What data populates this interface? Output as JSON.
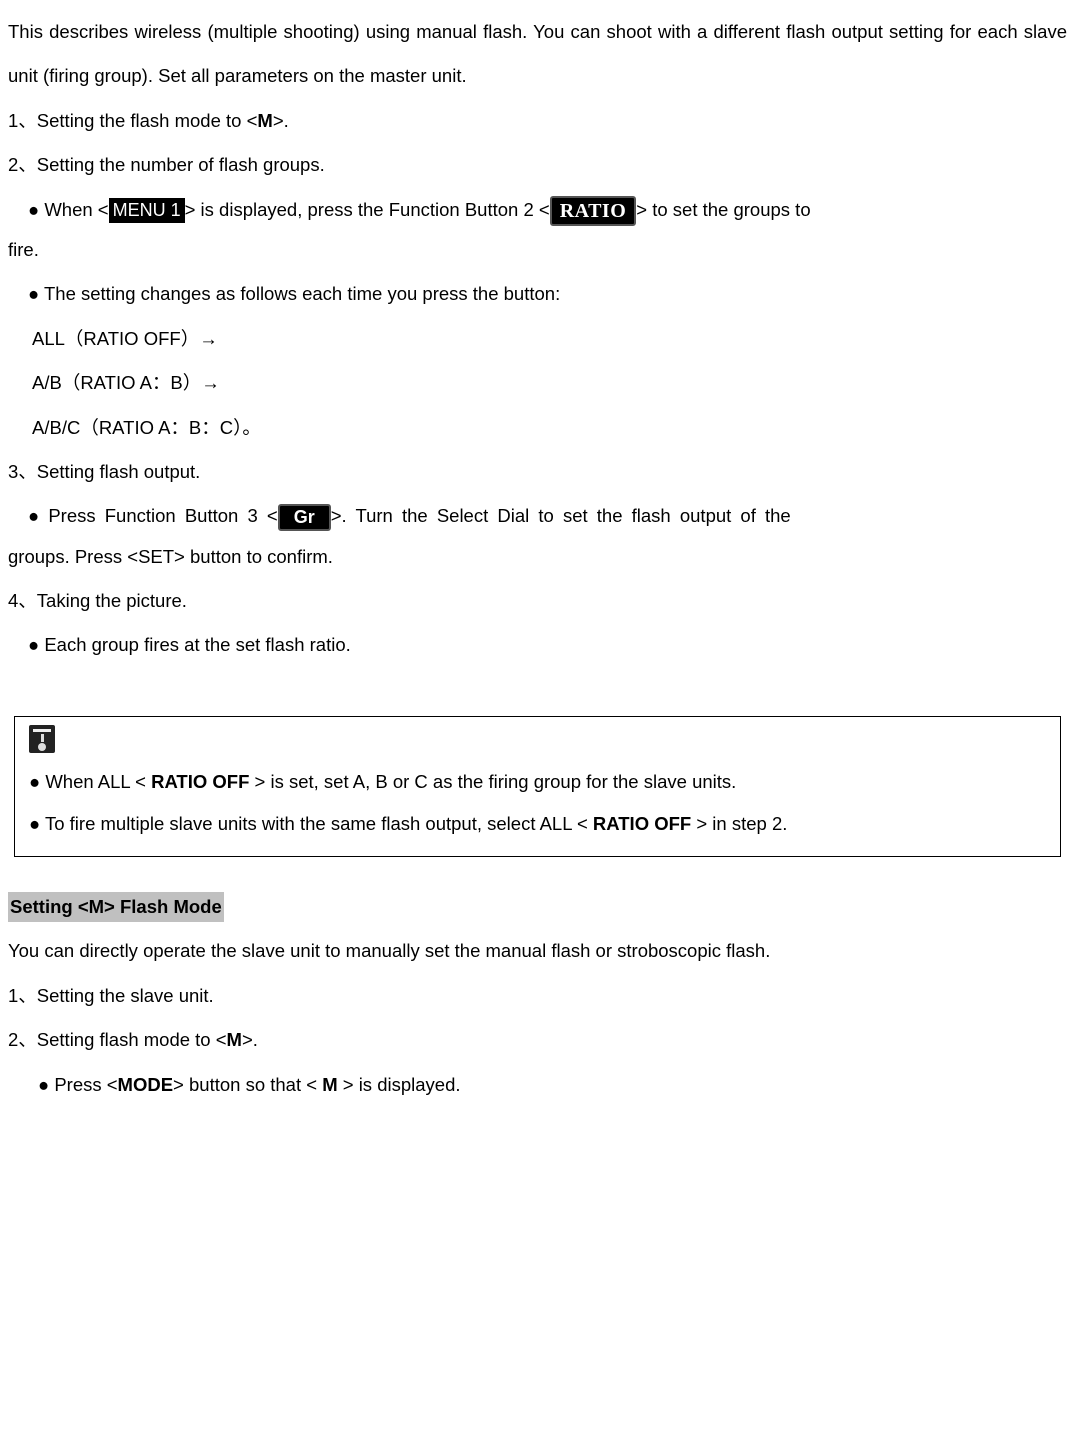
{
  "intro": "This describes wireless (multiple shooting) using manual flash. You can shoot with a different flash output setting for each slave unit (firing group). Set all parameters on the master unit.",
  "step1_pre": "1、Setting the flash mode to <",
  "step1_M": "M",
  "step1_post": ">.",
  "step2": "2、Setting the number of flash groups.",
  "step2_b1_pre": "● When <",
  "step2_b1_menu": "MENU 1",
  "step2_b1_mid": "> is displayed, press the Function Button 2 <",
  "step2_b1_ratio": "RATIO",
  "step2_b1_post": "> to set the groups to",
  "step2_b1_tail": "fire.",
  "step2_b2": "● The setting changes as follows each time you press the button:",
  "step2_seq1": "ALL（RATIO OFF）→",
  "step2_seq2": "A/B（RATIO A：B）→",
  "step2_seq3": "A/B/C（RATIO A：B：C）。",
  "step3": "3、Setting flash output.",
  "step3_b1_pre": "● Press Function Button 3 <",
  "step3_b1_gr": "Gr",
  "step3_b1_post": ">. Turn the Select Dial to set the flash output of the",
  "step3_tail": "groups. Press <SET> button to confirm.",
  "step4": "4、Taking the picture.",
  "step4_b1": "● Each group fires at the set flash ratio.",
  "note1_pre": "● When ALL < ",
  "note1_ratio_off": "RATIO OFF",
  "note1_post": " > is set, set A, B or C as the firing group for the slave units.",
  "note2_pre": "● To fire multiple slave units with the same flash output, select ALL < ",
  "note2_ratio_off": "RATIO OFF",
  "note2_post": " > in step 2.",
  "heading2": "Setting <M> Flash Mode",
  "sec2_intro": "You can directly operate the slave unit to manually set the manual flash or stroboscopic flash.",
  "sec2_step1": "1、Setting the slave unit.",
  "sec2_step2_pre": "2、Setting flash mode to <",
  "sec2_step2_M": "M",
  "sec2_step2_post": ">.",
  "sec2_b1_pre": "● Press <",
  "sec2_b1_mode": "MODE",
  "sec2_b1_mid": "> button so that < ",
  "sec2_b1_M": "M",
  "sec2_b1_post": " > is displayed."
}
